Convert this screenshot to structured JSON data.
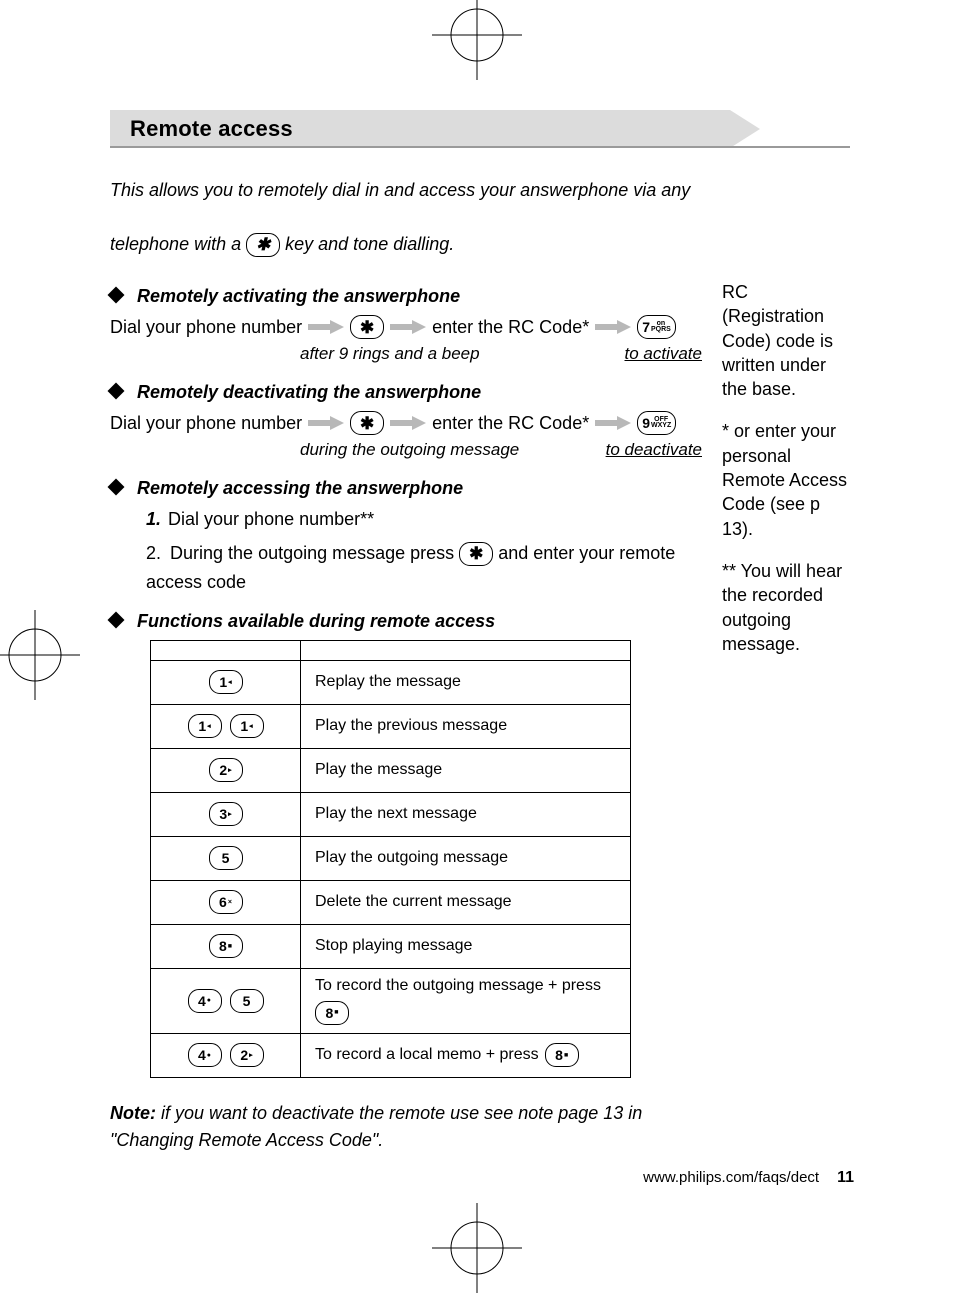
{
  "heading": "Remote access",
  "intro_part1": "This allows you to remotely dial in and access your answerphone via any",
  "intro_part2a": "telephone with a ",
  "intro_part2b": " key and tone dialling.",
  "sections": {
    "activate": {
      "title": "Remotely activating the answerphone",
      "step_a": "Dial your phone number",
      "step_b": "enter the RC Code*",
      "sub_left": "after 9 rings and a beep",
      "sub_right": "to activate",
      "end_key_main": "7",
      "end_key_sub": "on"
    },
    "deactivate": {
      "title": "Remotely deactivating the answerphone",
      "step_a": "Dial your phone number",
      "step_b": "enter the RC Code*",
      "sub_left": "during the outgoing message",
      "sub_right": "to deactivate",
      "end_key_main": "9",
      "end_key_sub": "OFF"
    },
    "access": {
      "title": "Remotely accessing the answerphone",
      "item1_num": "1.",
      "item1": " Dial your phone number**",
      "item2_num": "2.",
      "item2a": " During the outgoing message press ",
      "item2b": " and enter your remote access code"
    },
    "functions": {
      "title": "Functions available during remote access"
    }
  },
  "side": {
    "rc": "RC (Registration Code) code is written under the base.",
    "star": "* or enter your personal Remote Access Code (see p 13).",
    "dstar": "** You will hear the recorded outgoing message."
  },
  "table": {
    "rows": [
      {
        "keys": [
          {
            "m": "1",
            "s": "◂"
          }
        ],
        "desc": "Replay the message"
      },
      {
        "keys": [
          {
            "m": "1",
            "s": "◂"
          },
          {
            "m": "1",
            "s": "◂"
          }
        ],
        "desc": "Play the previous message"
      },
      {
        "keys": [
          {
            "m": "2",
            "s": "▸"
          }
        ],
        "desc": "Play the message"
      },
      {
        "keys": [
          {
            "m": "3",
            "s": "▸"
          }
        ],
        "desc": "Play the next message"
      },
      {
        "keys": [
          {
            "m": "5",
            "s": ""
          }
        ],
        "desc": "Play the outgoing message"
      },
      {
        "keys": [
          {
            "m": "6",
            "s": "×"
          }
        ],
        "desc": "Delete the current message"
      },
      {
        "keys": [
          {
            "m": "8",
            "s": "■"
          }
        ],
        "desc": "Stop playing message"
      },
      {
        "keys": [
          {
            "m": "4",
            "s": "●"
          },
          {
            "m": "5",
            "s": ""
          }
        ],
        "desc": "To record the outgoing message + press ",
        "suffix_key": {
          "m": "8",
          "s": "■"
        }
      },
      {
        "keys": [
          {
            "m": "4",
            "s": "●"
          },
          {
            "m": "2",
            "s": "▸"
          }
        ],
        "desc": "To record a local memo + press ",
        "suffix_key": {
          "m": "8",
          "s": "■"
        }
      }
    ]
  },
  "note_label": "Note:",
  "note_text": " if you want to deactivate the remote use see note page 13 in \"Changing Remote Access Code\".",
  "footer_url": "www.philips.com/faqs/dect",
  "footer_page": "11"
}
